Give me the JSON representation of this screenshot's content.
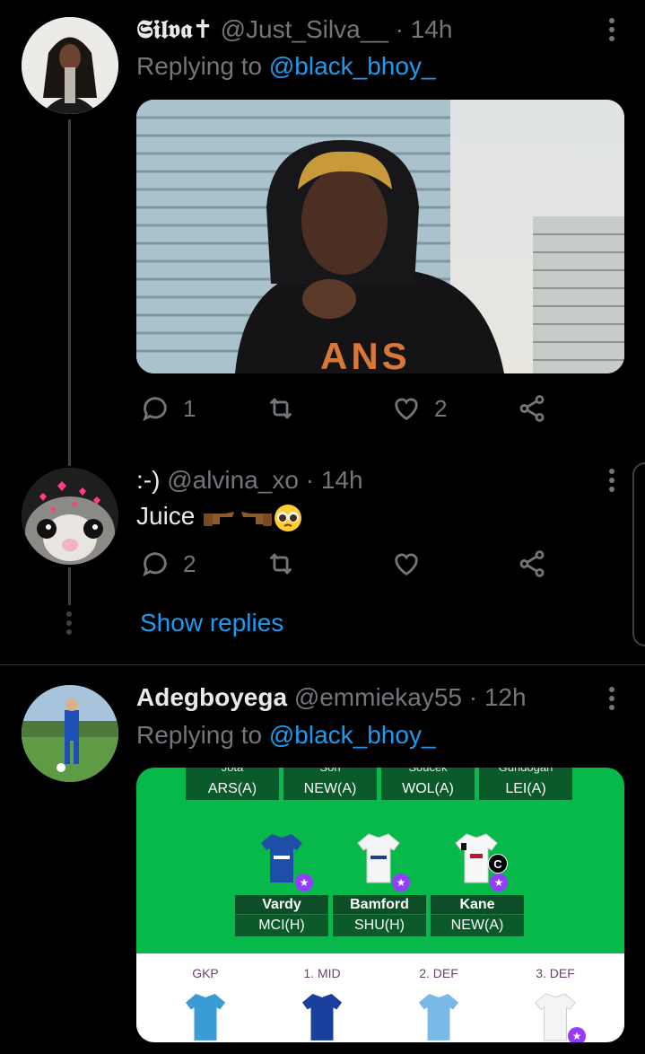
{
  "tweets": [
    {
      "display_name": "𝕾𝖎𝖑𝖛𝖆✝",
      "handle": "@Just_Silva__",
      "time": "· 14h",
      "replying_prefix": "Replying to ",
      "replying_to": "@black_bhoy_",
      "reply_count": "1",
      "retweet_count": "",
      "like_count": "2"
    },
    {
      "display_name": ":-)",
      "handle": "@alvina_xo",
      "time": "· 14h",
      "text": "Juice",
      "reply_count": "2",
      "retweet_count": "",
      "like_count": "",
      "show_replies": "Show replies"
    },
    {
      "display_name": "Adegboyega",
      "handle": "@emmiekay55",
      "time": "· 12h",
      "replying_prefix": "Replying to ",
      "replying_to": "@black_bhoy_"
    }
  ],
  "fpl": {
    "top_row": [
      {
        "name": "Jota",
        "fixture": "ARS(A)"
      },
      {
        "name": "Son",
        "fixture": "NEW(A)"
      },
      {
        "name": "Soucek",
        "fixture": "WOL(A)"
      },
      {
        "name": "Gundogan",
        "fixture": "LEI(A)"
      }
    ],
    "forwards": [
      {
        "name": "Vardy",
        "fixture": "MCI(H)"
      },
      {
        "name": "Bamford",
        "fixture": "SHU(H)"
      },
      {
        "name": "Kane",
        "fixture": "NEW(A)"
      }
    ],
    "captain_mark": "C",
    "bench": [
      "GKP",
      "1. MID",
      "2. DEF",
      "3. DEF"
    ]
  },
  "colors": {
    "link": "#1d9bf0",
    "muted": "#71767b",
    "pitch": "#07b84a"
  }
}
